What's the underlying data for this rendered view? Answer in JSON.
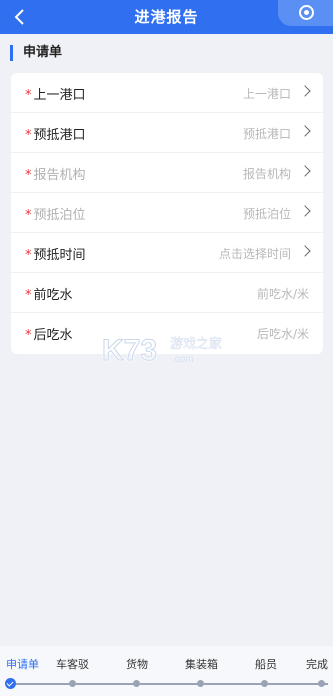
{
  "header": {
    "title": "进港报告"
  },
  "section": {
    "title": "申请单"
  },
  "form": {
    "rows": [
      {
        "label": "上一港口",
        "value": "上一港口",
        "required": true,
        "disabled": false,
        "arrow": true
      },
      {
        "label": "预抵港口",
        "value": "预抵港口",
        "required": true,
        "disabled": false,
        "arrow": true
      },
      {
        "label": "报告机构",
        "value": "报告机构",
        "required": true,
        "disabled": true,
        "arrow": true
      },
      {
        "label": "预抵泊位",
        "value": "预抵泊位",
        "required": true,
        "disabled": true,
        "arrow": true
      },
      {
        "label": "预抵时间",
        "value": "点击选择时间",
        "required": true,
        "disabled": false,
        "arrow": true
      },
      {
        "label": "前吃水",
        "value": "前吃水/米",
        "required": true,
        "disabled": false,
        "arrow": false
      },
      {
        "label": "后吃水",
        "value": "后吃水/米",
        "required": true,
        "disabled": false,
        "arrow": false
      }
    ]
  },
  "watermark": {
    "brand": "K73",
    "text": "游戏之家",
    "url": ".com"
  },
  "steps": [
    {
      "label": "申请单",
      "active": true
    },
    {
      "label": "车客驳",
      "active": false
    },
    {
      "label": "货物",
      "active": false
    },
    {
      "label": "集装箱",
      "active": false
    },
    {
      "label": "船员",
      "active": false
    },
    {
      "label": "完成",
      "active": false
    }
  ],
  "colors": {
    "primary": "#2f6ff0",
    "required": "#e23b3b"
  }
}
